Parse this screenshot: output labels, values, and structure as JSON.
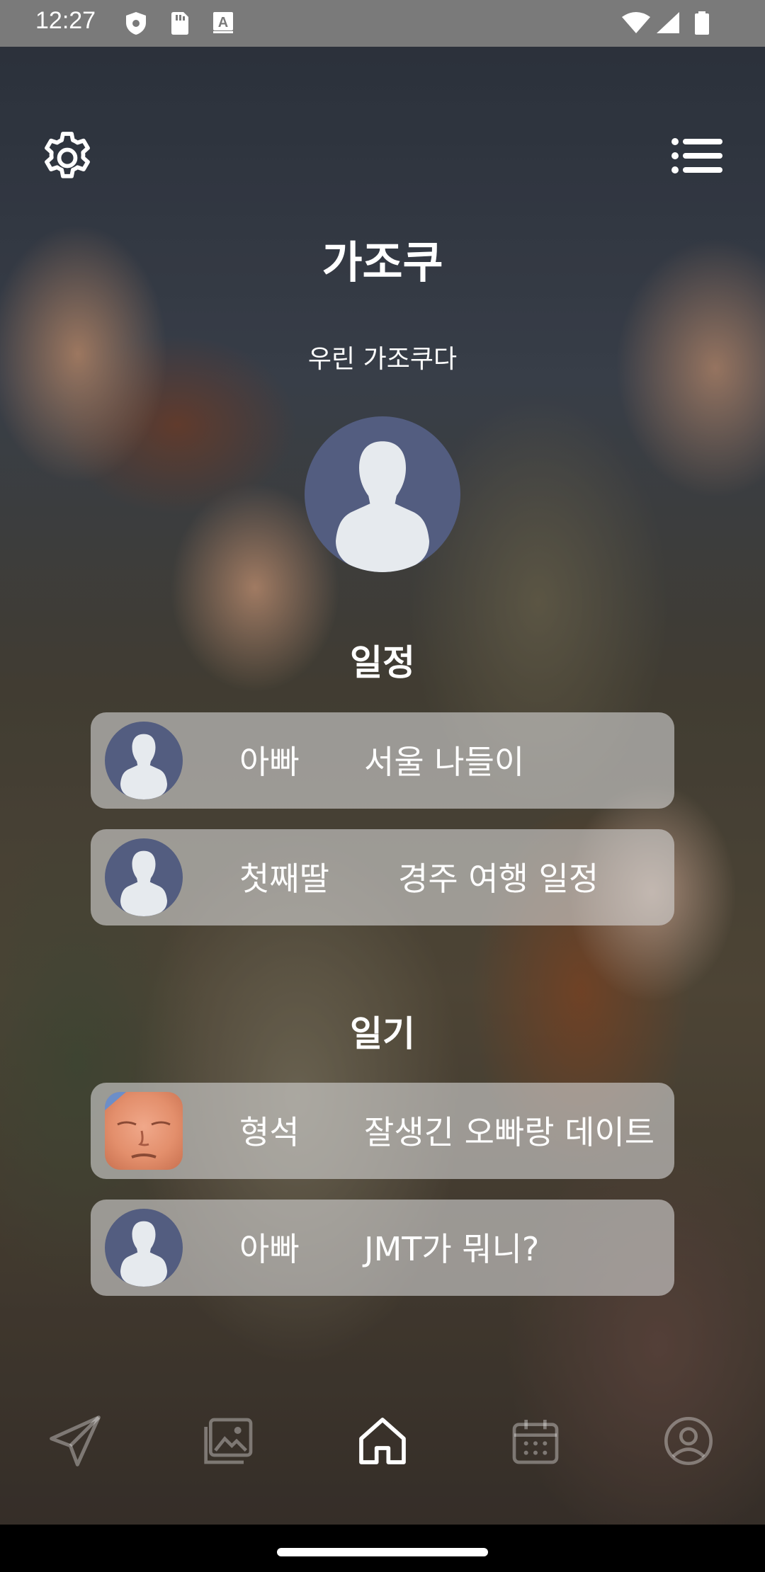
{
  "status_bar": {
    "time": "12:27",
    "icons": [
      "shield-icon",
      "sim-card-icon",
      "keyboard-a-icon",
      "wifi-icon",
      "signal-icon",
      "battery-icon"
    ]
  },
  "header": {
    "settings_icon": "gear-icon",
    "menu_icon": "list-menu-icon",
    "title": "가조쿠",
    "subtitle": "우린 가조쿠다"
  },
  "schedule": {
    "section_title": "일정",
    "items": [
      {
        "name": "아빠",
        "text": "서울 나들이",
        "avatar": "default-avatar"
      },
      {
        "name": "첫째딸",
        "text": "경주 여행 일정",
        "avatar": "default-avatar"
      }
    ]
  },
  "diary": {
    "section_title": "일기",
    "items": [
      {
        "name": "형석",
        "text": "잘생긴 오빠랑 데이트",
        "avatar": "photo-avatar"
      },
      {
        "name": "아빠",
        "text": "JMT가 뭐니?",
        "avatar": "default-avatar"
      }
    ]
  },
  "bottom_nav": {
    "items": [
      {
        "icon": "send-icon",
        "active": false
      },
      {
        "icon": "gallery-icon",
        "active": false
      },
      {
        "icon": "home-icon",
        "active": true
      },
      {
        "icon": "calendar-icon",
        "active": false
      },
      {
        "icon": "profile-icon",
        "active": false
      }
    ]
  },
  "colors": {
    "avatar_bg": "#535d80",
    "avatar_fg": "#e6eaee",
    "card_bg": "rgba(215,215,215,0.6)",
    "text": "#ffffff"
  }
}
